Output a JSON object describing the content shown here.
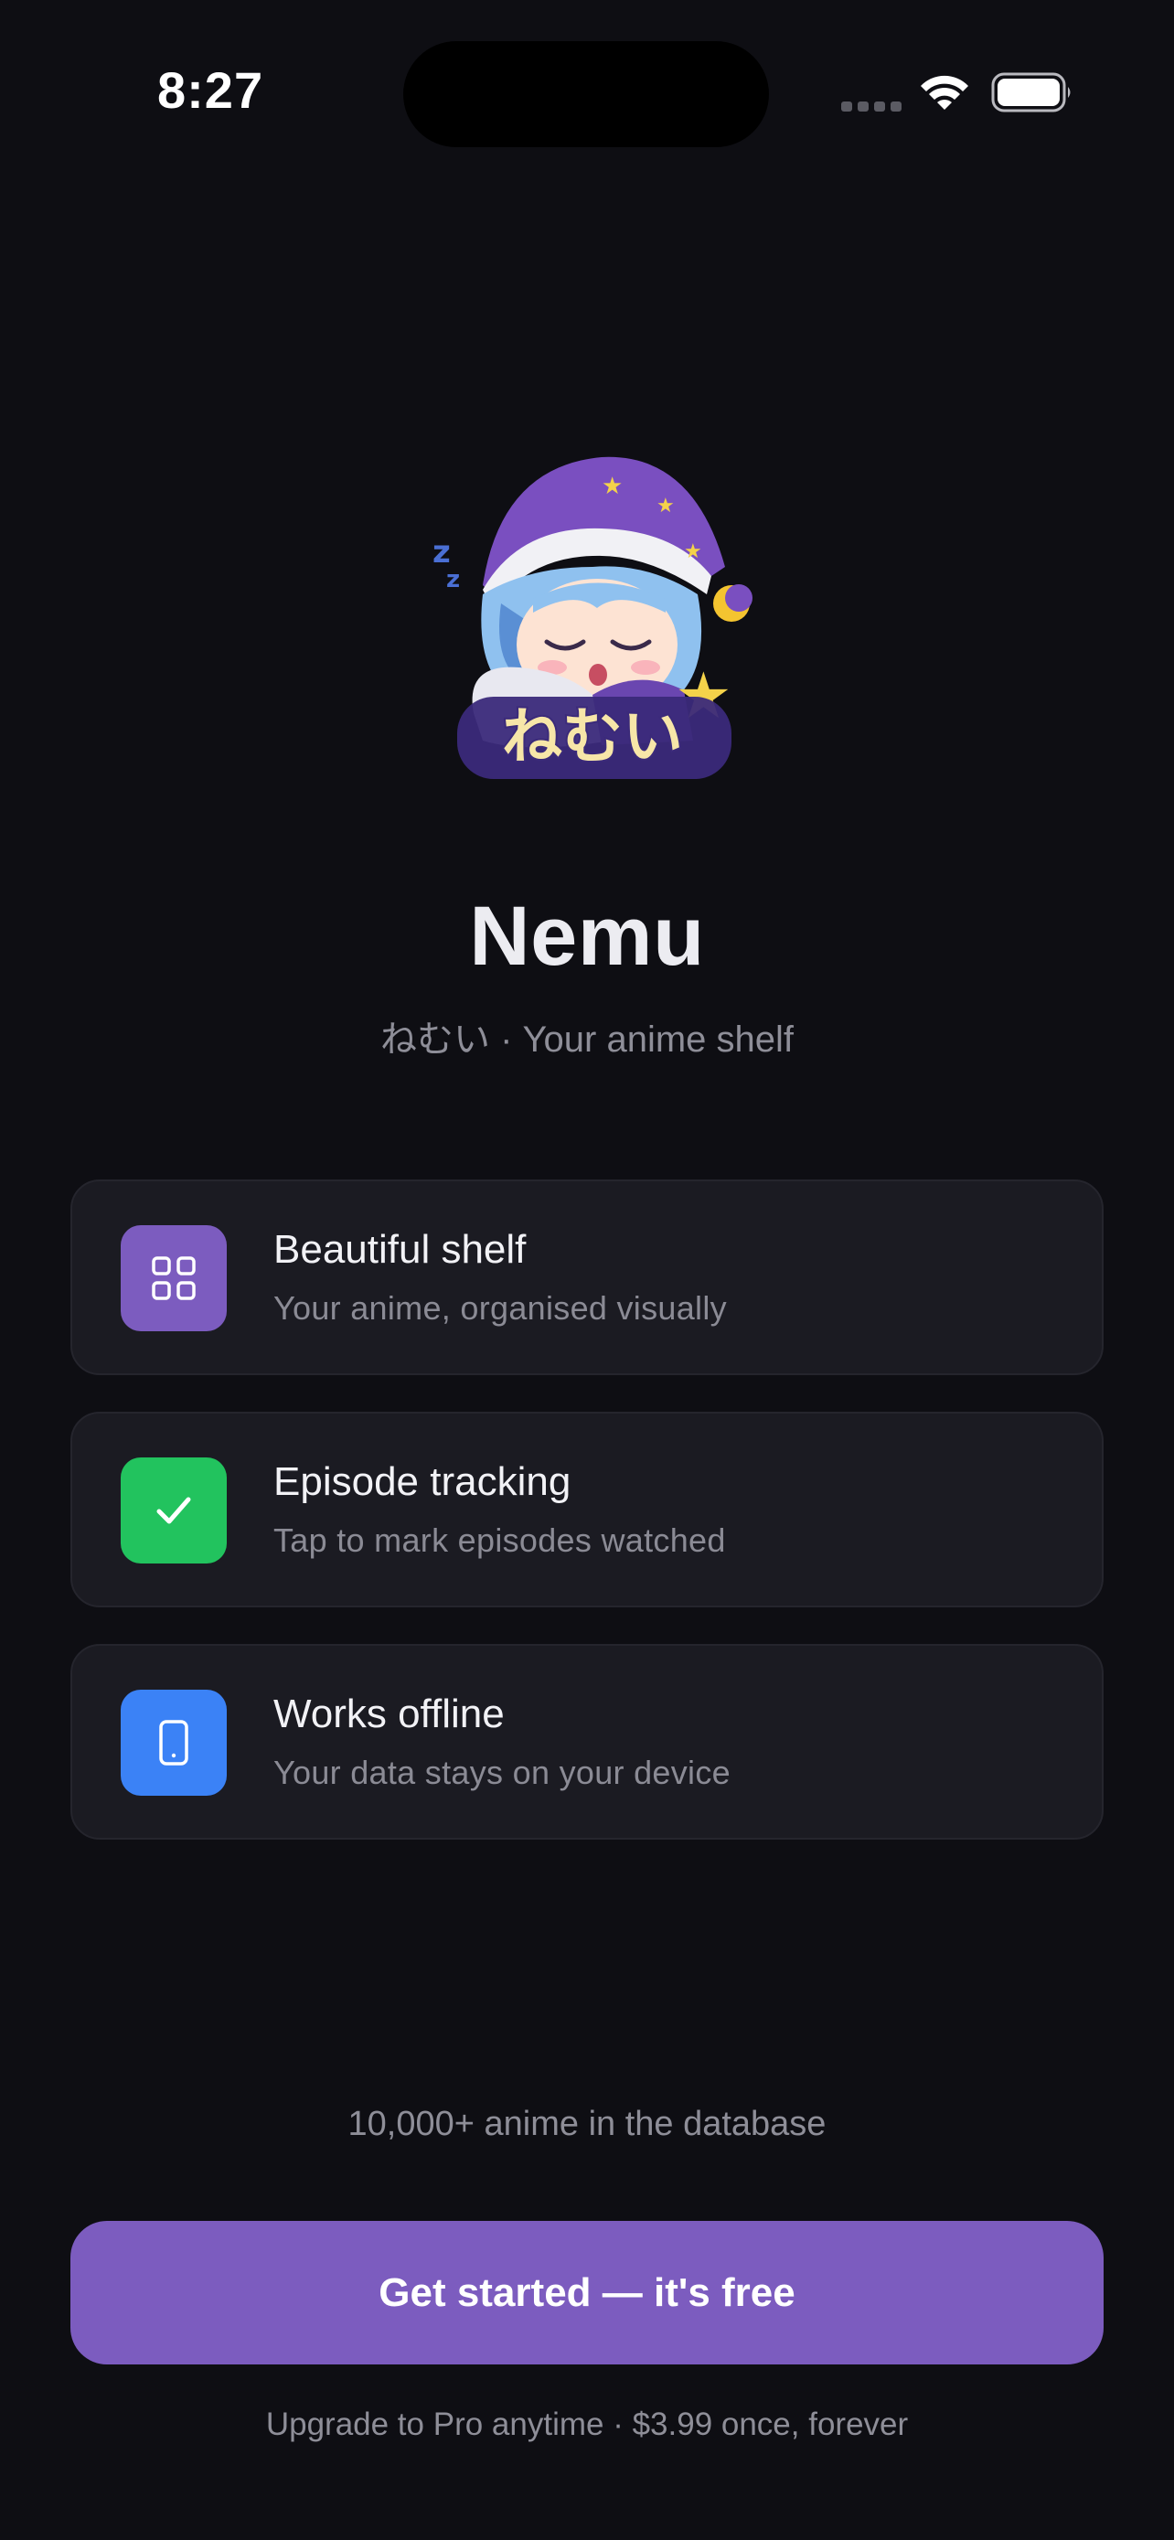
{
  "status_bar": {
    "time": "8:27",
    "wifi_icon": "wifi-icon",
    "battery_icon": "battery-icon"
  },
  "hero": {
    "mascot_icon": "sleepy-anime-mascot",
    "mascot_logo_text": "ねむい",
    "title": "Nemu",
    "subtitle": "ねむい · Your anime shelf"
  },
  "features": [
    {
      "title": "Beautiful shelf",
      "description": "Your anime, organised visually",
      "icon": "grid-icon",
      "color": "#7c5cbf"
    },
    {
      "title": "Episode tracking",
      "description": "Tap to mark episodes watched",
      "icon": "checkmark-icon",
      "color": "#22c35e"
    },
    {
      "title": "Works offline",
      "description": "Your data stays on your device",
      "icon": "phone-icon",
      "color": "#3b82f6"
    }
  ],
  "footer": {
    "database_count": "10,000+ anime in the database",
    "cta_label": "Get started — it's free",
    "pro_note": "Upgrade to Pro anytime · $3.99 once, forever"
  },
  "colors": {
    "background": "#0e0e13",
    "card": "#1b1b22",
    "accent": "#7c5cbf"
  }
}
